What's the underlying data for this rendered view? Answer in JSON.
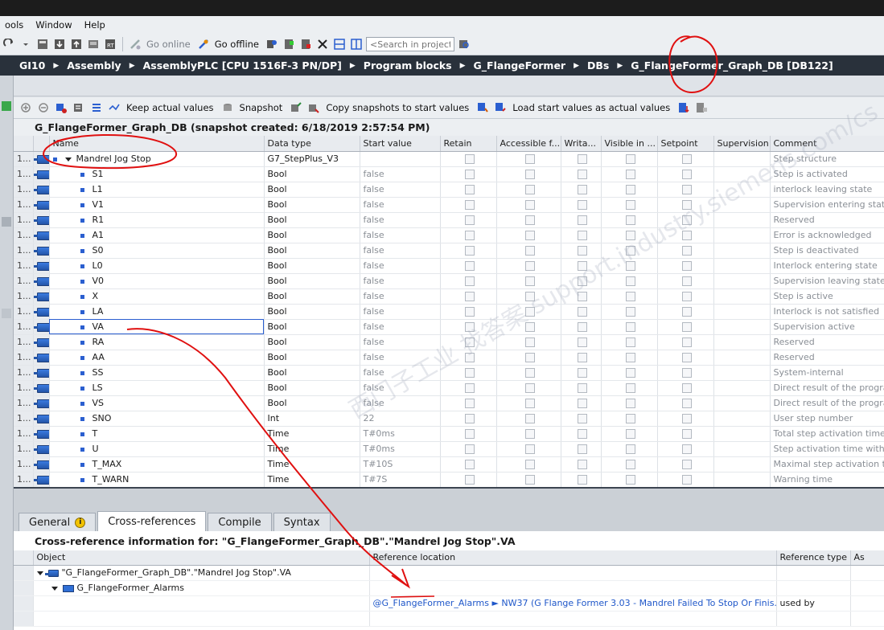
{
  "menu": [
    "ools",
    "Window",
    "Help"
  ],
  "toolbar": {
    "go_online": "Go online",
    "go_offline": "Go offline",
    "search_placeholder": "<Search in project>"
  },
  "breadcrumb": [
    "GI10",
    "Assembly",
    "AssemblyPLC [CPU 1516F-3 PN/DP]",
    "Program blocks",
    "G_FlangeFormer",
    "DBs",
    "G_FlangeFormer_Graph_DB [DB122]"
  ],
  "editor_toolbar": {
    "keep_actual": "Keep actual values",
    "snapshot": "Snapshot",
    "copy_snapshots": "Copy snapshots to start values",
    "load_start": "Load start values as actual values"
  },
  "db_title": "G_FlangeFormer_Graph_DB (snapshot created: 6/18/2019 2:57:54 PM)",
  "table": {
    "columns": [
      "Name",
      "Data type",
      "Start value",
      "Retain",
      "Accessible f...",
      "Writa...",
      "Visible in ...",
      "Setpoint",
      "Supervision",
      "Comment"
    ],
    "row_num": "1...",
    "rows": [
      {
        "name": "Mandrel Jog Stop",
        "type": "G7_StepPlus_V3",
        "start": "",
        "comment": "Step structure",
        "parent": true
      },
      {
        "name": "S1",
        "type": "Bool",
        "start": "false",
        "comment": "Step is activated"
      },
      {
        "name": "L1",
        "type": "Bool",
        "start": "false",
        "comment": "interlock leaving state"
      },
      {
        "name": "V1",
        "type": "Bool",
        "start": "false",
        "comment": "Supervision entering state"
      },
      {
        "name": "R1",
        "type": "Bool",
        "start": "false",
        "comment": "Reserved"
      },
      {
        "name": "A1",
        "type": "Bool",
        "start": "false",
        "comment": "Error is acknowledged"
      },
      {
        "name": "S0",
        "type": "Bool",
        "start": "false",
        "comment": "Step is deactivated"
      },
      {
        "name": "L0",
        "type": "Bool",
        "start": "false",
        "comment": "Interlock entering state"
      },
      {
        "name": "V0",
        "type": "Bool",
        "start": "false",
        "comment": "Supervision leaving state"
      },
      {
        "name": "X",
        "type": "Bool",
        "start": "false",
        "comment": "Step is active"
      },
      {
        "name": "LA",
        "type": "Bool",
        "start": "false",
        "comment": "Interlock is not satisfied"
      },
      {
        "name": "VA",
        "type": "Bool",
        "start": "false",
        "comment": "Supervision active",
        "selected": true
      },
      {
        "name": "RA",
        "type": "Bool",
        "start": "false",
        "comment": "Reserved"
      },
      {
        "name": "AA",
        "type": "Bool",
        "start": "false",
        "comment": "Reserved"
      },
      {
        "name": "SS",
        "type": "Bool",
        "start": "false",
        "comment": "System-internal"
      },
      {
        "name": "LS",
        "type": "Bool",
        "start": "false",
        "comment": "Direct result of the progra"
      },
      {
        "name": "VS",
        "type": "Bool",
        "start": "false",
        "comment": "Direct result of the progra"
      },
      {
        "name": "SNO",
        "type": "Int",
        "start": "22",
        "comment": "User step number"
      },
      {
        "name": "T",
        "type": "Time",
        "start": "T#0ms",
        "comment": "Total step activation time"
      },
      {
        "name": "U",
        "type": "Time",
        "start": "T#0ms",
        "comment": "Step activation time witho"
      },
      {
        "name": "T_MAX",
        "type": "Time",
        "start": "T#10S",
        "comment": "Maximal step activation ti"
      },
      {
        "name": "T_WARN",
        "type": "Time",
        "start": "T#7S",
        "comment": "Warning time"
      }
    ]
  },
  "tabs": [
    "General",
    "Cross-references",
    "Compile",
    "Syntax"
  ],
  "info_badge": "i",
  "xref": {
    "title": "Cross-reference information for: \"G_FlangeFormer_Graph_DB\".\"Mandrel Jog Stop\".VA",
    "columns": [
      "Object",
      "Reference location",
      "Reference type",
      "As"
    ],
    "object_root": "\"G_FlangeFormer_Graph_DB\".\"Mandrel Jog Stop\".VA",
    "object_child": "G_FlangeFormer_Alarms",
    "reference_location": "@G_FlangeFormer_Alarms ► NW37 (G Flange Former 3.03 - Mandrel Failed To Stop Or Finis...",
    "reference_type": "used by"
  },
  "watermark": "西门子工业 找答案 support.industry.siemens.com/cs",
  "colors": {
    "breadcrumb_bg": "#29313b",
    "annotation": "#e01010",
    "link": "#1f57c9"
  }
}
